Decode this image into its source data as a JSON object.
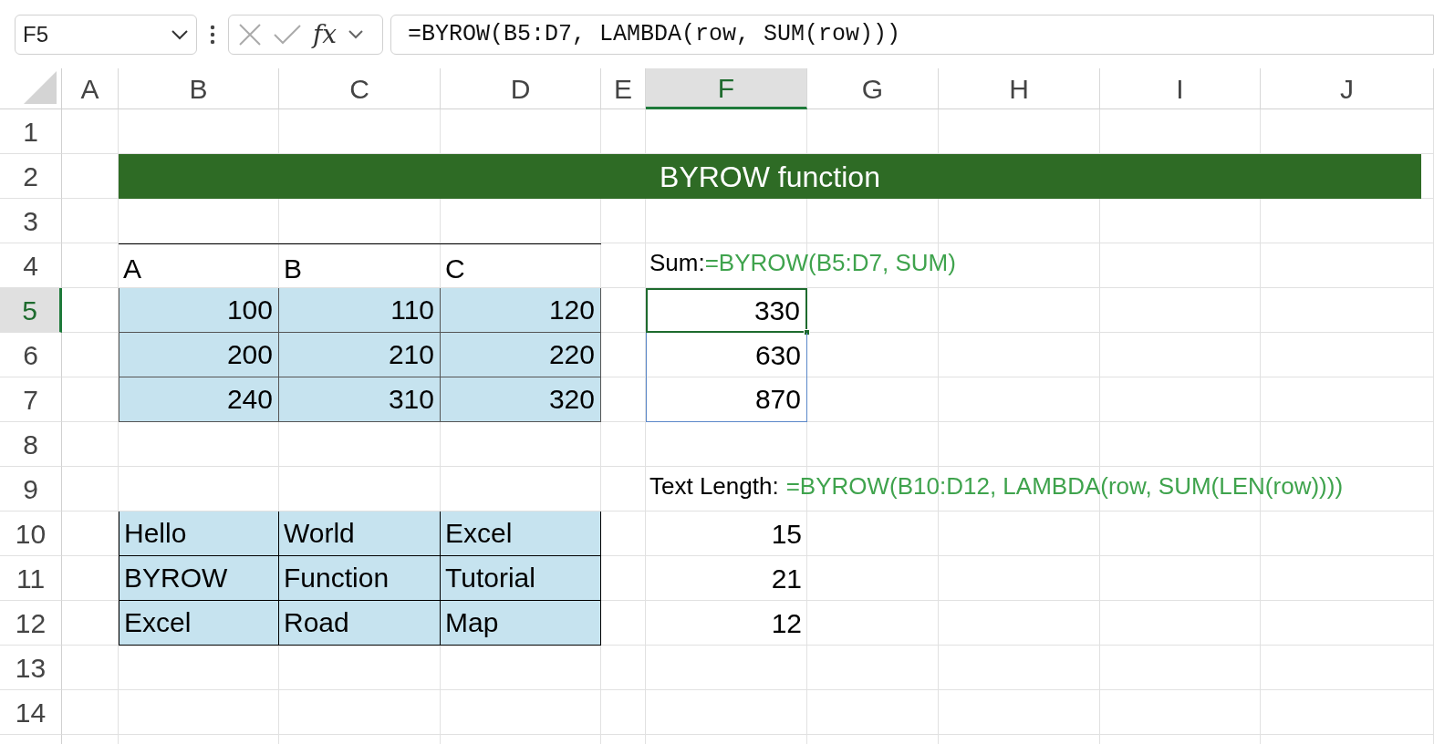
{
  "formula_bar": {
    "name_box": "F5",
    "fx": "fx",
    "formula": "=BYROW(B5:D7, LAMBDA(row, SUM(row)))"
  },
  "columns": [
    {
      "header": "A",
      "selected": false
    },
    {
      "header": "B",
      "selected": false
    },
    {
      "header": "C",
      "selected": false
    },
    {
      "header": "D",
      "selected": false
    },
    {
      "header": "E",
      "selected": false
    },
    {
      "header": "F",
      "selected": true
    },
    {
      "header": "G",
      "selected": false
    },
    {
      "header": "H",
      "selected": false
    },
    {
      "header": "I",
      "selected": false
    },
    {
      "header": "J",
      "selected": false
    }
  ],
  "rows": [
    {
      "header": "1",
      "selected": false
    },
    {
      "header": "2",
      "selected": false,
      "banner": "BYROW function"
    },
    {
      "header": "3",
      "selected": false
    },
    {
      "header": "4",
      "selected": false,
      "table_cells": [
        {
          "kind": "header",
          "text": "A"
        },
        {
          "kind": "header",
          "text": "B"
        },
        {
          "kind": "header",
          "text": "C"
        }
      ],
      "f_cell": {
        "kind": "caption",
        "label": "Sum:",
        "formula": "=BYROW(B5:D7, SUM)",
        "spaced": false
      }
    },
    {
      "header": "5",
      "selected": true,
      "table_cells": [
        {
          "kind": "number",
          "text": "100"
        },
        {
          "kind": "number",
          "text": "110"
        },
        {
          "kind": "number",
          "text": "120"
        }
      ],
      "f_cell": {
        "kind": "result",
        "text": "330",
        "selected": true
      }
    },
    {
      "header": "6",
      "selected": false,
      "table_cells": [
        {
          "kind": "number",
          "text": "200"
        },
        {
          "kind": "number",
          "text": "210"
        },
        {
          "kind": "number",
          "text": "220"
        }
      ],
      "f_cell": {
        "kind": "result",
        "text": "630",
        "selected": false
      }
    },
    {
      "header": "7",
      "selected": false,
      "table_cells": [
        {
          "kind": "number",
          "text": "240"
        },
        {
          "kind": "number",
          "text": "310"
        },
        {
          "kind": "number",
          "text": "320"
        }
      ],
      "f_cell": {
        "kind": "result",
        "text": "870",
        "selected": false
      }
    },
    {
      "header": "8",
      "selected": false
    },
    {
      "header": "9",
      "selected": false,
      "f_cell": {
        "kind": "caption",
        "label": "Text Length:",
        "formula": "=BYROW(B10:D12, LAMBDA(row, SUM(LEN(row))))",
        "spaced": true
      }
    },
    {
      "header": "10",
      "selected": false,
      "table_cells": [
        {
          "kind": "word",
          "text": "Hello"
        },
        {
          "kind": "word",
          "text": "World"
        },
        {
          "kind": "word",
          "text": "Excel"
        }
      ],
      "f_cell": {
        "kind": "plain",
        "text": "15"
      }
    },
    {
      "header": "11",
      "selected": false,
      "table_cells": [
        {
          "kind": "word",
          "text": "BYROW"
        },
        {
          "kind": "word",
          "text": "Function"
        },
        {
          "kind": "word",
          "text": "Tutorial"
        }
      ],
      "f_cell": {
        "kind": "plain",
        "text": "21"
      }
    },
    {
      "header": "12",
      "selected": false,
      "table_cells": [
        {
          "kind": "word",
          "text": "Excel"
        },
        {
          "kind": "word",
          "text": "Road"
        },
        {
          "kind": "word",
          "text": "Map"
        }
      ],
      "f_cell": {
        "kind": "plain",
        "text": "12"
      }
    },
    {
      "header": "13",
      "selected": false
    },
    {
      "header": "14",
      "selected": false
    }
  ]
}
